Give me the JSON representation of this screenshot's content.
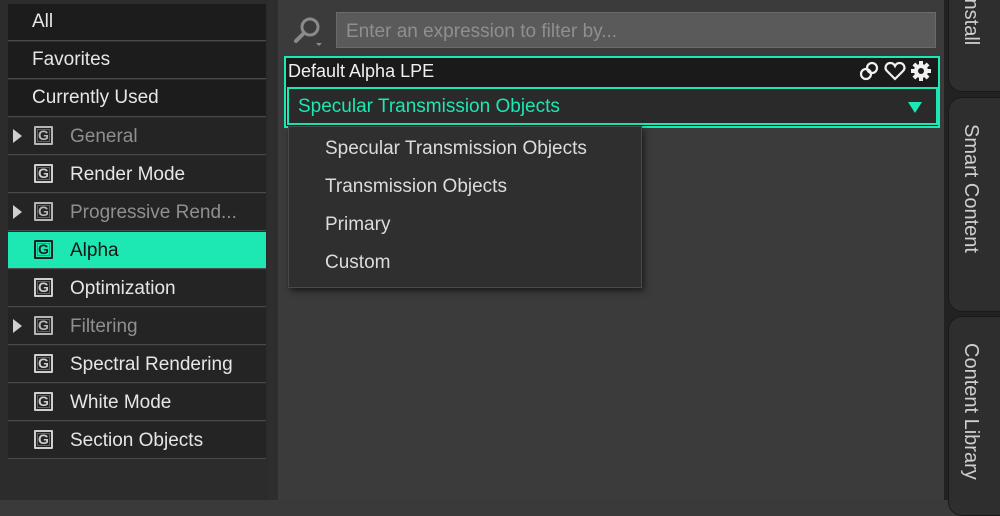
{
  "sidebar": {
    "items": [
      {
        "label": "All",
        "type": "plain"
      },
      {
        "label": "Favorites",
        "type": "plain"
      },
      {
        "label": "Currently Used",
        "type": "plain"
      },
      {
        "label": "General",
        "type": "group",
        "expandable": true,
        "dim": true
      },
      {
        "label": "Render Mode",
        "type": "group",
        "expandable": false,
        "dim": false
      },
      {
        "label": "Progressive Rend...",
        "type": "group",
        "expandable": true,
        "dim": true
      },
      {
        "label": "Alpha",
        "type": "group",
        "expandable": false,
        "dim": false,
        "active": true
      },
      {
        "label": "Optimization",
        "type": "group",
        "expandable": false,
        "dim": false
      },
      {
        "label": "Filtering",
        "type": "group",
        "expandable": true,
        "dim": true
      },
      {
        "label": "Spectral Rendering",
        "type": "group",
        "expandable": false,
        "dim": false
      },
      {
        "label": "White Mode",
        "type": "group",
        "expandable": false,
        "dim": false
      },
      {
        "label": "Section Objects",
        "type": "group",
        "expandable": false,
        "dim": false
      }
    ],
    "group_icon_letter": "G"
  },
  "search": {
    "placeholder": "Enter an expression to filter by..."
  },
  "property": {
    "title": "Default Alpha LPE",
    "selected": "Specular Transmission Objects",
    "icons": [
      "link-icon",
      "heart-icon",
      "gear-icon"
    ]
  },
  "dropdown_menu": {
    "options": [
      "Specular Transmission Objects",
      "Transmission Objects",
      "Primary",
      "Custom"
    ]
  },
  "side_tabs": {
    "tab1": "Install",
    "tab2": "Smart Content",
    "tab3": "Content Library"
  },
  "colors": {
    "accent": "#1de7b3",
    "background": "#3a3a3a",
    "sidebar": "#242424"
  }
}
